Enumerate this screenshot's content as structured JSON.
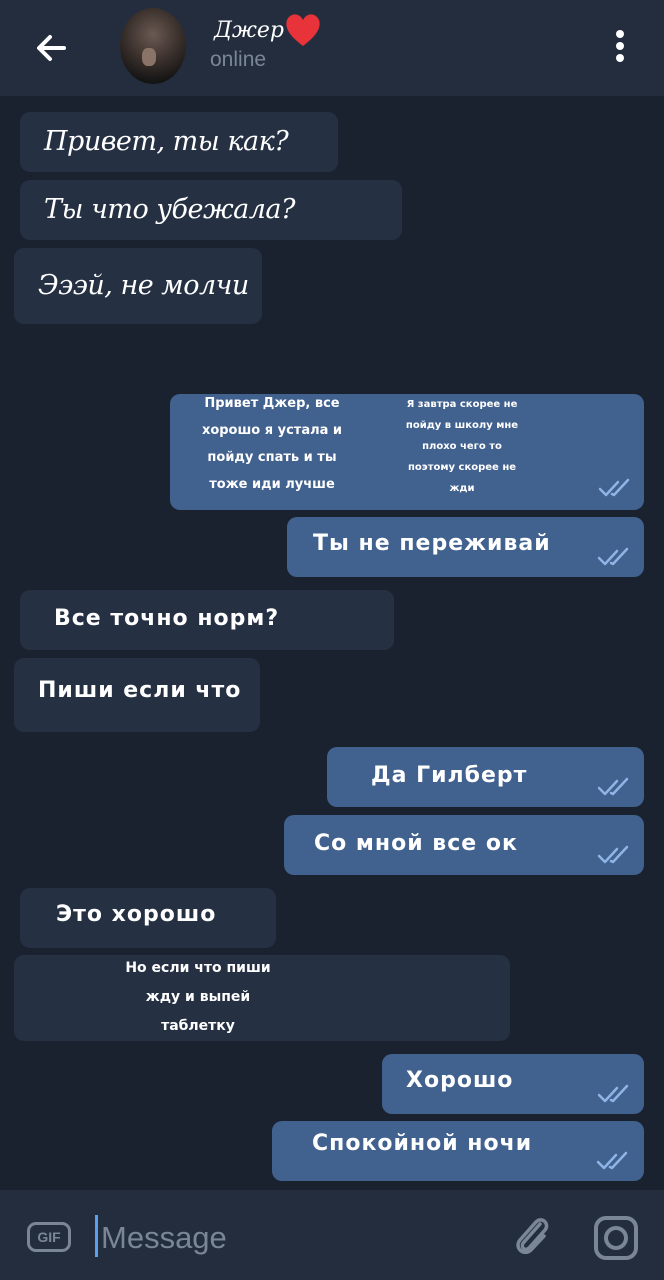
{
  "header": {
    "contact_name": "Джер",
    "status": "online",
    "icons": [
      "back-arrow-icon",
      "heart-icon",
      "more-vert-icon"
    ]
  },
  "messages": [
    {
      "dir": "in",
      "text": "Привет, ты как?"
    },
    {
      "dir": "in",
      "text": "Ты что убежала?"
    },
    {
      "dir": "in",
      "text": "Эээй, не молчи"
    },
    {
      "dir": "out",
      "text_left": "Привет Джер, все\nхорошо я устала и\nпойду спать и ты\nтоже иди лучше",
      "text_right": "Я завтра скорее не\nпойду в школу мне\nплохо чего то\nпоэтому скорее не\nжди",
      "read": true
    },
    {
      "dir": "out",
      "text": "Ты не переживай",
      "read": true
    },
    {
      "dir": "in",
      "text": "Все точно норм?"
    },
    {
      "dir": "in",
      "text": "Пиши если что"
    },
    {
      "dir": "out",
      "text": "Да Гилберт",
      "read": true
    },
    {
      "dir": "out",
      "text": "Со мной все ок",
      "read": true
    },
    {
      "dir": "in",
      "text": "Это хорошо"
    },
    {
      "dir": "in",
      "text": "Но если что пиши\nжду и выпей\nтаблетку"
    },
    {
      "dir": "out",
      "text": "Хорошо",
      "read": true
    },
    {
      "dir": "out",
      "text": "Спокойной ночи",
      "read": true
    }
  ],
  "composer": {
    "gif_label": "GIF",
    "placeholder": "Message",
    "icons": [
      "gif-icon",
      "attach-icon",
      "camera-icon"
    ]
  },
  "colors": {
    "background": "#1a2230",
    "header": "#232d3d",
    "incoming_bubble": "#253043",
    "outgoing_bubble": "#41618f",
    "secondary_text": "#7a8696",
    "read_check": "#8fb4e6"
  }
}
